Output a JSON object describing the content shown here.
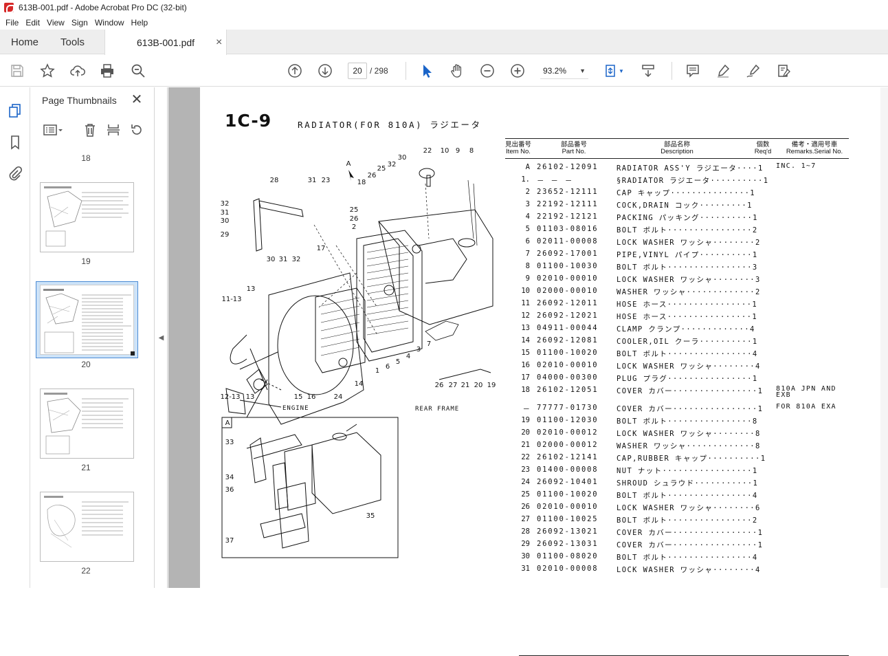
{
  "window": {
    "title": "613B-001.pdf - Adobe Acrobat Pro DC (32-bit)"
  },
  "menu": [
    "File",
    "Edit",
    "View",
    "Sign",
    "Window",
    "Help"
  ],
  "tabs": {
    "home": "Home",
    "tools": "Tools",
    "document": "613B-001.pdf",
    "close": "×"
  },
  "toolbar": {
    "current_page": "20",
    "total_pages": "/ 298",
    "zoom": "93.2%"
  },
  "thumbnails": {
    "title": "Page Thumbnails",
    "close": "✕",
    "top_label": "18",
    "pages": [
      {
        "label": "19",
        "selected": false
      },
      {
        "label": "20",
        "selected": true
      },
      {
        "label": "21",
        "selected": false
      },
      {
        "label": "22",
        "selected": false
      }
    ]
  },
  "document": {
    "code": "1C-9",
    "subtitle": "RADIATOR(FOR 810A)  ラジエータ",
    "headers": {
      "item": "見出番号\nItem No.",
      "part": "部品番号\nPart No.",
      "desc": "部品名称\nDescription",
      "qty": "個数\nReq'd",
      "remarks": "備考・適用号車\nRemarks.Serial No."
    },
    "diagram_labels": {
      "view_a": "A",
      "engine": "ENGINE",
      "rear_frame": "REAR FRAME",
      "numbers": [
        "22",
        "10",
        "9",
        "8",
        "32",
        "25",
        "30",
        "26",
        "18",
        "28",
        "31",
        "23",
        "32",
        "31",
        "30",
        "29",
        "25",
        "26",
        "2",
        "30",
        "31",
        "32",
        "17",
        "13",
        "11-13",
        "12-13",
        "13",
        "15",
        "16",
        "24",
        "14",
        "1",
        "6",
        "5",
        "4",
        "3",
        "7",
        "26",
        "27",
        "21",
        "20",
        "19",
        "33",
        "34",
        "36",
        "37",
        "35"
      ]
    },
    "parts": [
      {
        "item": "A",
        "part": "26102-12091",
        "desc": "RADIATOR ASS'Y ラジエータ····1",
        "remarks": "INC. 1~7"
      },
      {
        "item": "1.",
        "part": "－ － －",
        "desc": "§RADIATOR ラジエータ··········1",
        "remarks": ""
      },
      {
        "item": "2",
        "part": "23652-12111",
        "desc": "CAP キャップ···············1",
        "remarks": ""
      },
      {
        "item": "3",
        "part": "22192-12111",
        "desc": "COCK,DRAIN コック·········1",
        "remarks": ""
      },
      {
        "item": "4",
        "part": "22192-12121",
        "desc": "PACKING パッキング··········1",
        "remarks": ""
      },
      {
        "item": "5",
        "part": "01103-08016",
        "desc": "BOLT ボルト················2",
        "remarks": ""
      },
      {
        "item": "6",
        "part": "02011-00008",
        "desc": "LOCK WASHER ワッシャ········2",
        "remarks": ""
      },
      {
        "item": "7",
        "part": "26092-17001",
        "desc": "PIPE,VINYL パイプ··········1",
        "remarks": ""
      },
      {
        "item": "8",
        "part": "01100-10030",
        "desc": "BOLT ボルト················3",
        "remarks": ""
      },
      {
        "item": "9",
        "part": "02010-00010",
        "desc": "LOCK WASHER ワッシャ········3",
        "remarks": ""
      },
      {
        "item": "10",
        "part": "02000-00010",
        "desc": "WASHER ワッシャ·············2",
        "remarks": ""
      },
      {
        "item": "11",
        "part": "26092-12011",
        "desc": "HOSE ホース················1",
        "remarks": ""
      },
      {
        "item": "12",
        "part": "26092-12021",
        "desc": "HOSE ホース················1",
        "remarks": ""
      },
      {
        "item": "13",
        "part": "04911-00044",
        "desc": "CLAMP クランプ·············4",
        "remarks": ""
      },
      {
        "item": "14",
        "part": "26092-12081",
        "desc": "COOLER,OIL クーラ··········1",
        "remarks": ""
      },
      {
        "item": "15",
        "part": "01100-10020",
        "desc": "BOLT ボルト················4",
        "remarks": ""
      },
      {
        "item": "16",
        "part": "02010-00010",
        "desc": "LOCK WASHER ワッシャ········4",
        "remarks": ""
      },
      {
        "item": "17",
        "part": "04000-00300",
        "desc": "PLUG プラグ················1",
        "remarks": ""
      },
      {
        "item": "18",
        "part": "26102-12051",
        "desc": "COVER カバー················1",
        "remarks": "810A JPN AND\nEXB"
      },
      {
        "item": "－",
        "part": "77777-01730",
        "desc": "COVER カバー················1",
        "remarks": "FOR 810A EXA"
      },
      {
        "item": "19",
        "part": "01100-12030",
        "desc": "BOLT ボルト················8",
        "remarks": ""
      },
      {
        "item": "20",
        "part": "02010-00012",
        "desc": "LOCK WASHER ワッシャ········8",
        "remarks": ""
      },
      {
        "item": "21",
        "part": "02000-00012",
        "desc": "WASHER ワッシャ·············8",
        "remarks": ""
      },
      {
        "item": "22",
        "part": "26102-12141",
        "desc": "CAP,RUBBER キャップ··········1",
        "remarks": ""
      },
      {
        "item": "23",
        "part": "01400-00008",
        "desc": "NUT ナット·················1",
        "remarks": ""
      },
      {
        "item": "24",
        "part": "26092-10401",
        "desc": "SHROUD シュラウド···········1",
        "remarks": ""
      },
      {
        "item": "25",
        "part": "01100-10020",
        "desc": "BOLT ボルト················4",
        "remarks": ""
      },
      {
        "item": "26",
        "part": "02010-00010",
        "desc": "LOCK WASHER ワッシャ········6",
        "remarks": ""
      },
      {
        "item": "27",
        "part": "01100-10025",
        "desc": "BOLT ボルト················2",
        "remarks": ""
      },
      {
        "item": "28",
        "part": "26092-13021",
        "desc": "COVER カバー················1",
        "remarks": ""
      },
      {
        "item": "29",
        "part": "26092-13031",
        "desc": "COVER カバー················1",
        "remarks": ""
      },
      {
        "item": "30",
        "part": "01100-08020",
        "desc": "BOLT ボルト················4",
        "remarks": ""
      },
      {
        "item": "31",
        "part": "02010-00008",
        "desc": "LOCK WASHER ワッシャ········4",
        "remarks": ""
      }
    ]
  }
}
